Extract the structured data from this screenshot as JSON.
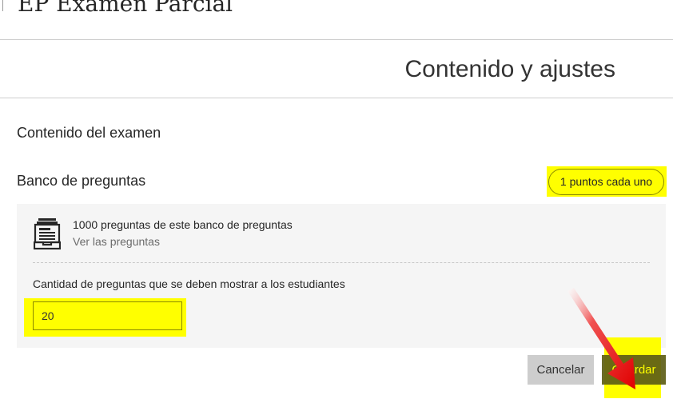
{
  "header": {
    "page_title": "EP Examen Parcial"
  },
  "panel": {
    "title": "Contenido y ajustes"
  },
  "content": {
    "section_title": "Contenido del examen",
    "bank_title": "Banco de preguntas",
    "points_badge": "1 puntos cada uno"
  },
  "bank": {
    "count_text": "1000 preguntas de este banco de preguntas",
    "view_link": "Ver las preguntas",
    "quantity_label": "Cantidad de preguntas que se deben mostrar a los estudiantes",
    "quantity_value": "20"
  },
  "actions": {
    "cancel_label": "Cancelar",
    "save_label": "Guardar"
  },
  "colors": {
    "highlight": "#ffff00",
    "save_button": "#5e5e16",
    "cancel_button": "#cdcdcd",
    "arrow": "#e01010"
  }
}
